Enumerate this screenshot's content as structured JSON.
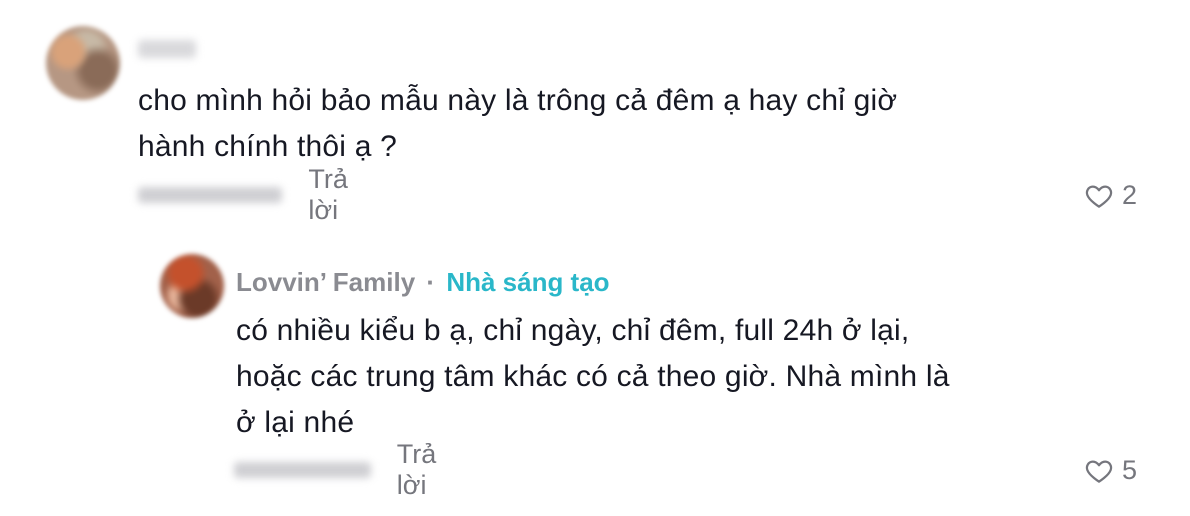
{
  "comments": [
    {
      "text_lines": [
        "cho mình hỏi bảo mẫu này là trông cả đêm ạ hay chỉ giờ",
        "hành chính thôi ạ ?"
      ],
      "reply_label": "Trả lời",
      "like_count": "2"
    }
  ],
  "replies": [
    {
      "author": "Lovvin’ Family",
      "separator": "·",
      "badge": "Nhà sáng tạo",
      "text_lines": [
        "có nhiều kiểu b ạ, chỉ ngày, chỉ đêm, full 24h ở lại,",
        "hoặc các trung tâm khác có cả theo giờ. Nhà mình là",
        "ở lại nhé"
      ],
      "reply_label": "Trả lời",
      "like_count": "5"
    }
  ],
  "icons": {
    "like": "heart-outline-icon"
  },
  "colors": {
    "text": "#161823",
    "secondary": "#75767d",
    "creator_badge": "#2ab7c9"
  }
}
